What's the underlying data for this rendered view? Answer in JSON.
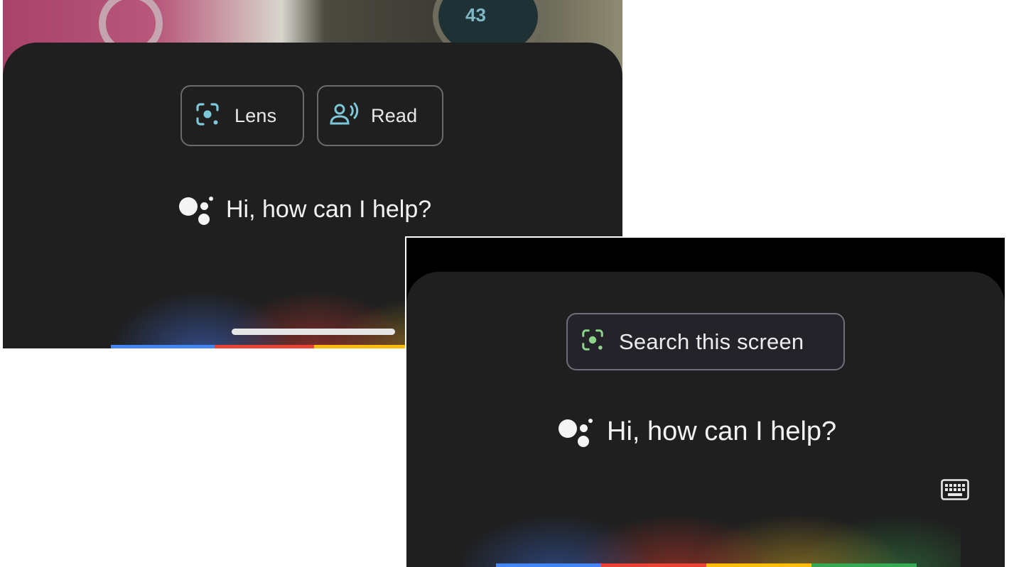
{
  "screen_a": {
    "background": {
      "watch_reading": "43"
    },
    "chips": [
      {
        "label": "Lens",
        "icon": "lens-icon"
      },
      {
        "label": "Read",
        "icon": "read-aloud-icon"
      }
    ],
    "greeting": "Hi, how can I help?",
    "colors": {
      "sheet": "#1f1f1f",
      "chip_icon": "#7cc7d8"
    }
  },
  "screen_b": {
    "chip": {
      "label": "Search this screen",
      "icon": "lens-icon"
    },
    "greeting": "Hi, how can I help?",
    "keyboard_icon": "keyboard-icon",
    "colors": {
      "sheet": "#1f1f1f",
      "chip_icon": "#8bd48a"
    }
  },
  "brand_colors": [
    "#4285f4",
    "#ea4335",
    "#fbbc05",
    "#34a853"
  ]
}
